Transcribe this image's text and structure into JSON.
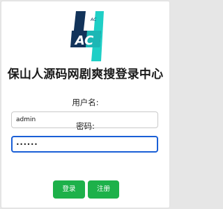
{
  "logo": {
    "text": "AC",
    "small_text": "AC",
    "colors": {
      "dark": "#12335a",
      "accent": "#1fcfc6"
    }
  },
  "title": "保山人源码网剧爽搜登录中心",
  "form": {
    "username_label": "用户名:",
    "username_value": "admin",
    "password_label": "密码:",
    "password_value": "••••••"
  },
  "buttons": {
    "login_label": "登录",
    "register_label": "注册",
    "color": "#1db14a"
  }
}
